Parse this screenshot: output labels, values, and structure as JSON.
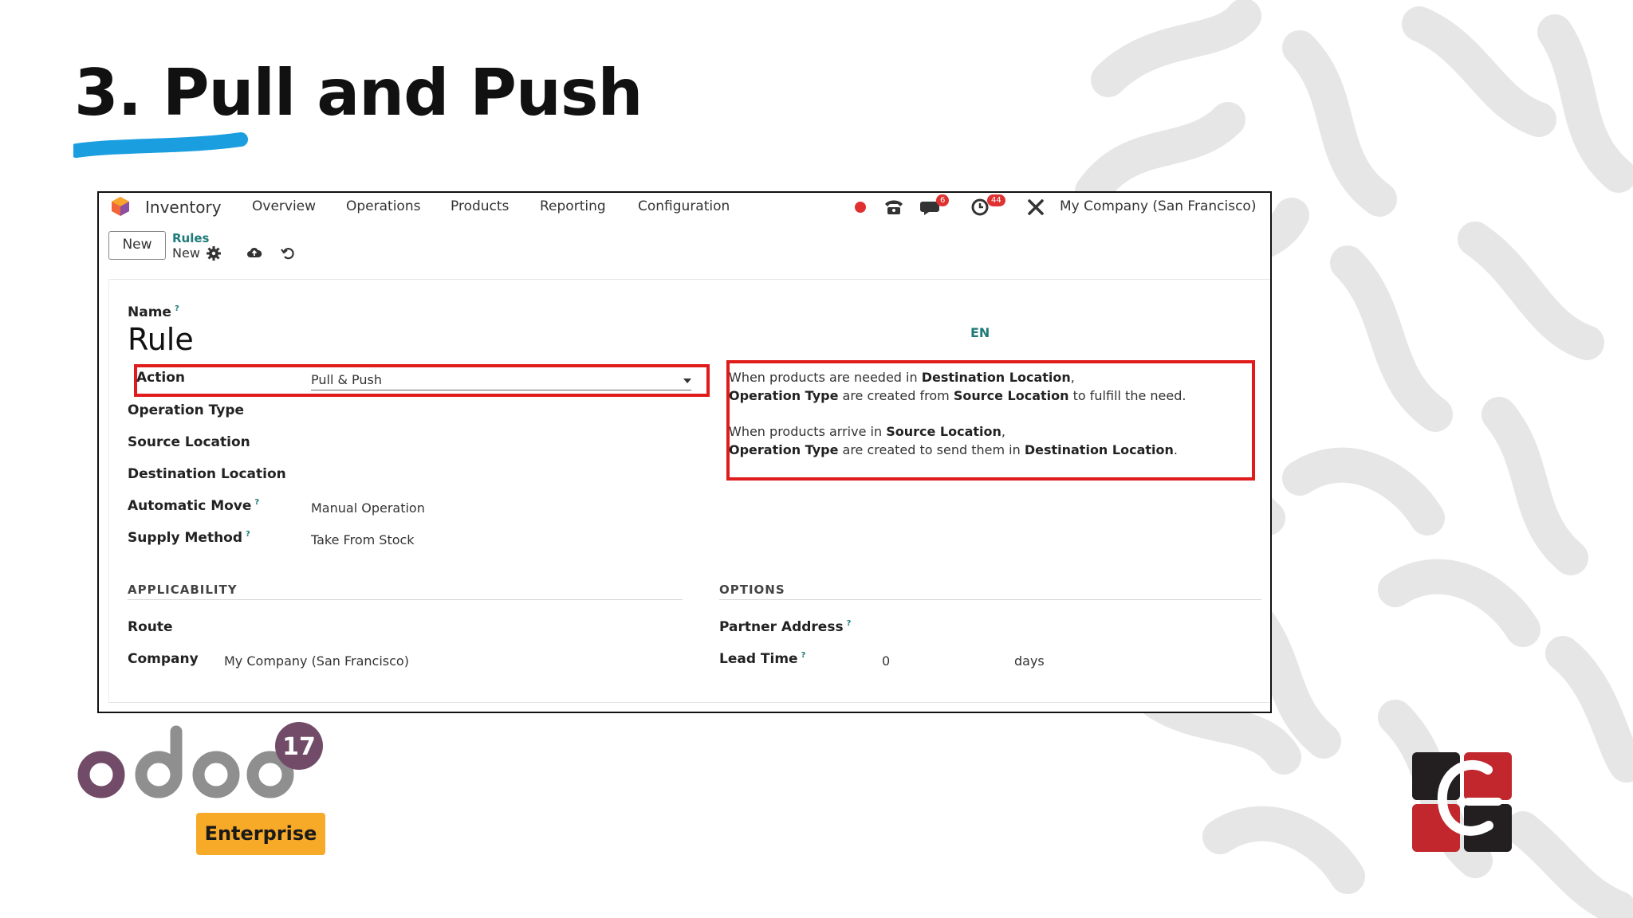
{
  "slide": {
    "title": "3. Pull and Push"
  },
  "topbar": {
    "app_name": "Inventory",
    "menu": [
      "Overview",
      "Operations",
      "Products",
      "Reporting",
      "Configuration"
    ],
    "messages_badge": "6",
    "activities_badge": "44",
    "company": "My Company (San Francisco)",
    "icons": [
      "status-dot-icon",
      "phone-icon",
      "chat-icon",
      "clock-icon",
      "tools-icon"
    ]
  },
  "control": {
    "new_button": "New",
    "breadcrumb_parent": "Rules",
    "breadcrumb_current": "New"
  },
  "form": {
    "name_label": "Name",
    "name_help": "?",
    "name_value": "Rule",
    "lang": "EN",
    "action_label": "Action",
    "action_value": "Pull & Push",
    "operation_type_label": "Operation Type",
    "source_location_label": "Source Location",
    "destination_location_label": "Destination Location",
    "automatic_move_label": "Automatic Move",
    "automatic_move_help": "?",
    "automatic_move_value": "Manual Operation",
    "supply_method_label": "Supply Method",
    "supply_method_help": "?",
    "supply_method_value": "Take From Stock"
  },
  "info": {
    "p1_a": "When products are needed in ",
    "p1_b": "Destination Location",
    "p1_c": ",",
    "p1_d": "Operation Type",
    "p1_e": " are created from ",
    "p1_f": "Source Location",
    "p1_g": " to fulfill the need.",
    "p2_a": "When products arrive in ",
    "p2_b": "Source Location",
    "p2_c": ",",
    "p2_d": "Operation Type",
    "p2_e": " are created to send them in ",
    "p2_f": "Destination Location",
    "p2_g": "."
  },
  "applicability": {
    "header": "APPLICABILITY",
    "route_label": "Route",
    "company_label": "Company",
    "company_value": "My Company (San Francisco)"
  },
  "options": {
    "header": "OPTIONS",
    "partner_address_label": "Partner Address",
    "partner_address_help": "?",
    "lead_time_label": "Lead Time",
    "lead_time_help": "?",
    "lead_time_value": "0",
    "lead_time_unit": "days"
  },
  "branding": {
    "product_name": "odoo",
    "version": "17",
    "edition": "Enterprise",
    "colors": {
      "accent": "#1a9ee0",
      "highlight": "#e01b1b",
      "edition_bg": "#f7a928",
      "odoo_purple": "#714b67"
    }
  }
}
